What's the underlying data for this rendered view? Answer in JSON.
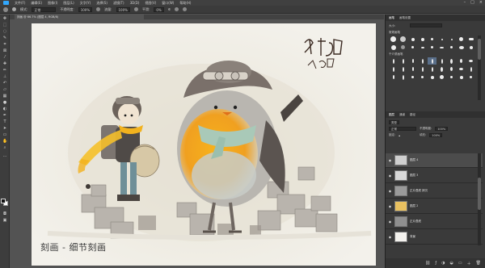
{
  "menubar": {
    "items": [
      "文件(F)",
      "编辑(E)",
      "图像(I)",
      "图层(L)",
      "文字(Y)",
      "选择(S)",
      "滤镜(T)",
      "3D(D)",
      "视图(V)",
      "窗口(W)",
      "帮助(H)"
    ]
  },
  "options": {
    "mode_label": "模式:",
    "mode_value": "正常",
    "opacity_label": "不透明度:",
    "opacity_value": "100%",
    "flow_label": "流量:",
    "flow_value": "100%",
    "smooth_label": "平滑:",
    "smooth_value": "0%"
  },
  "document": {
    "tab_title": "刻画 @ 66.7% (图层 4, RGB/8)",
    "caption": "刻画 - 细节刻画",
    "signature": "刻画",
    "signature2": "人猫白"
  },
  "brushes_panel": {
    "tabs": [
      "画笔",
      "画笔设置"
    ],
    "size_label": "大小:",
    "group1": "常规画笔",
    "group2": "干介质画笔"
  },
  "layers_panel": {
    "tabs": [
      "图层",
      "通道",
      "路径"
    ],
    "kind_label": "类型",
    "blend_mode": "正常",
    "opacity_label": "不透明度:",
    "opacity_value": "100%",
    "fill_label": "填充:",
    "fill_value": "100%",
    "lock_label": "锁定:",
    "layers": [
      {
        "name": "图层 4"
      },
      {
        "name": "图层 3"
      },
      {
        "name": "正片叠底 拷贝"
      },
      {
        "name": "图层 2"
      },
      {
        "name": "正片叠底"
      },
      {
        "name": "背景"
      }
    ]
  },
  "colors": {
    "accent": "#31a8ff",
    "panel_bg": "#3a3a3a",
    "canvas_bg": "#f2f0ea"
  }
}
